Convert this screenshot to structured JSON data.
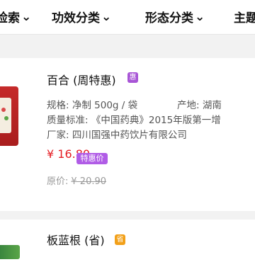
{
  "tabs": [
    {
      "label": "能源检索",
      "visible": "检索"
    },
    {
      "label": "功效分类"
    },
    {
      "label": "形态分类"
    },
    {
      "label": "主题"
    }
  ],
  "chevron": "⌄",
  "products": [
    {
      "name": "百合 (周特惠)",
      "badge": "惠",
      "spec_label": "规格:",
      "spec_value": "净制 500g / 袋",
      "origin_label": "产地:",
      "origin_value": "湖南",
      "standard_label": "质量标准:",
      "standard_value": "《中国药典》2015年版第一增",
      "maker_label": "厂家:",
      "maker_value": "四川国强中药饮片有限公司",
      "price": "¥ 16.80",
      "price_tag": "特惠价",
      "orig_label": "原价:",
      "orig_price": "¥ 20.90"
    },
    {
      "name": "板蓝根 (省)",
      "badge": "省"
    }
  ],
  "colors": {
    "price": "#e51c23",
    "badge_purple": "#a855d6",
    "badge_orange": "#f2a019"
  }
}
